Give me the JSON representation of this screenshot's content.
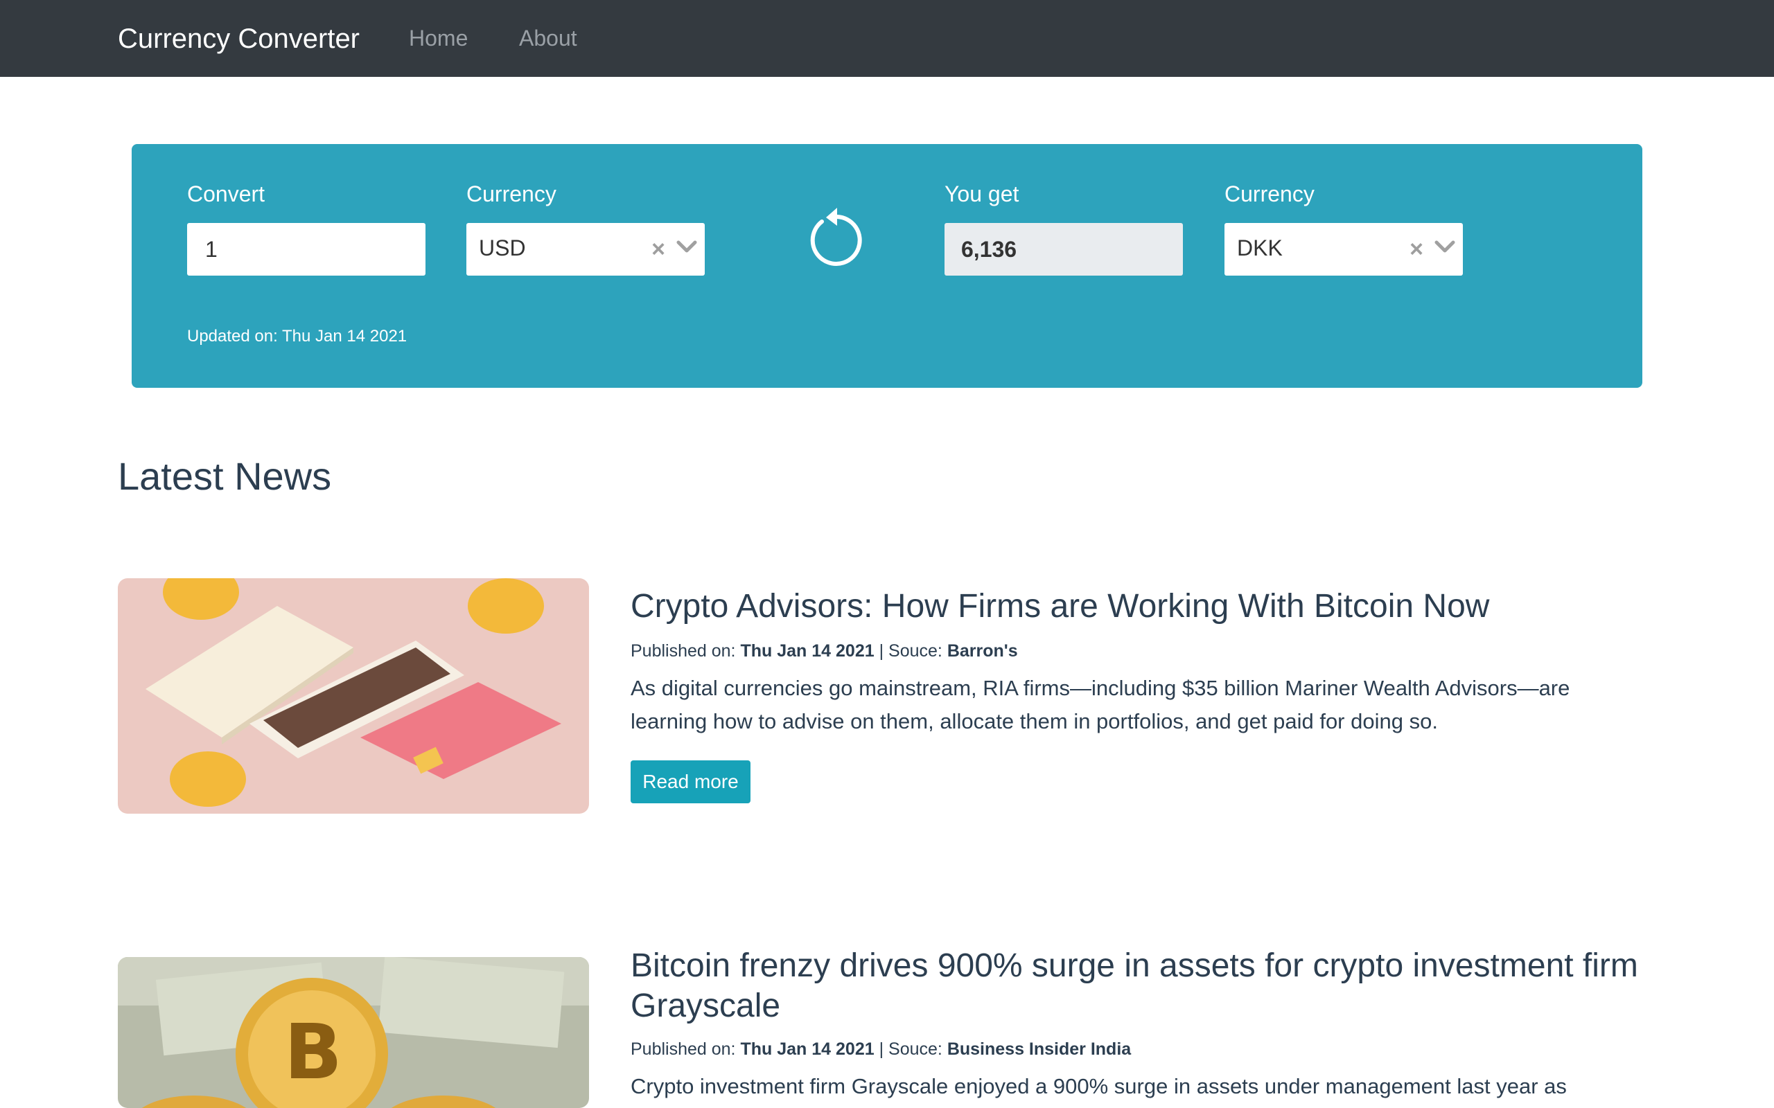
{
  "navbar": {
    "brand": "Currency Converter",
    "links": [
      "Home",
      "About"
    ]
  },
  "converter": {
    "convert_label": "Convert",
    "convert_value": "1",
    "from_currency_label": "Currency",
    "from_currency": "USD",
    "you_get_label": "You get",
    "result_value": "6,136",
    "to_currency_label": "Currency",
    "to_currency": "DKK",
    "updated_prefix": "Updated on:",
    "updated_date": "Thu Jan 14 2021"
  },
  "news": {
    "section_title": "Latest News",
    "published_prefix": "Published on:",
    "source_prefix": "| Souce:",
    "read_more": "Read more",
    "articles": [
      {
        "title": "Crypto Advisors: How Firms are Working With Bitcoin Now",
        "date": "Thu Jan 14 2021",
        "source": "Barron's",
        "description": "As digital currencies go mainstream, RIA firms—including $35 billion Mariner Wealth Advisors—are learning how to advise on them, allocate them in portfolios, and get paid for doing so."
      },
      {
        "title": "Bitcoin frenzy drives 900% surge in assets for crypto investment firm Grayscale",
        "date": "Thu Jan 14 2021",
        "source": "Business Insider India",
        "description": "Crypto investment firm Grayscale enjoyed a 900% surge in assets under management last year as"
      }
    ]
  },
  "colors": {
    "navbar": "#343a40",
    "converter_panel": "#2da3bc",
    "button": "#17a2b8",
    "text": "#2c3e50"
  }
}
